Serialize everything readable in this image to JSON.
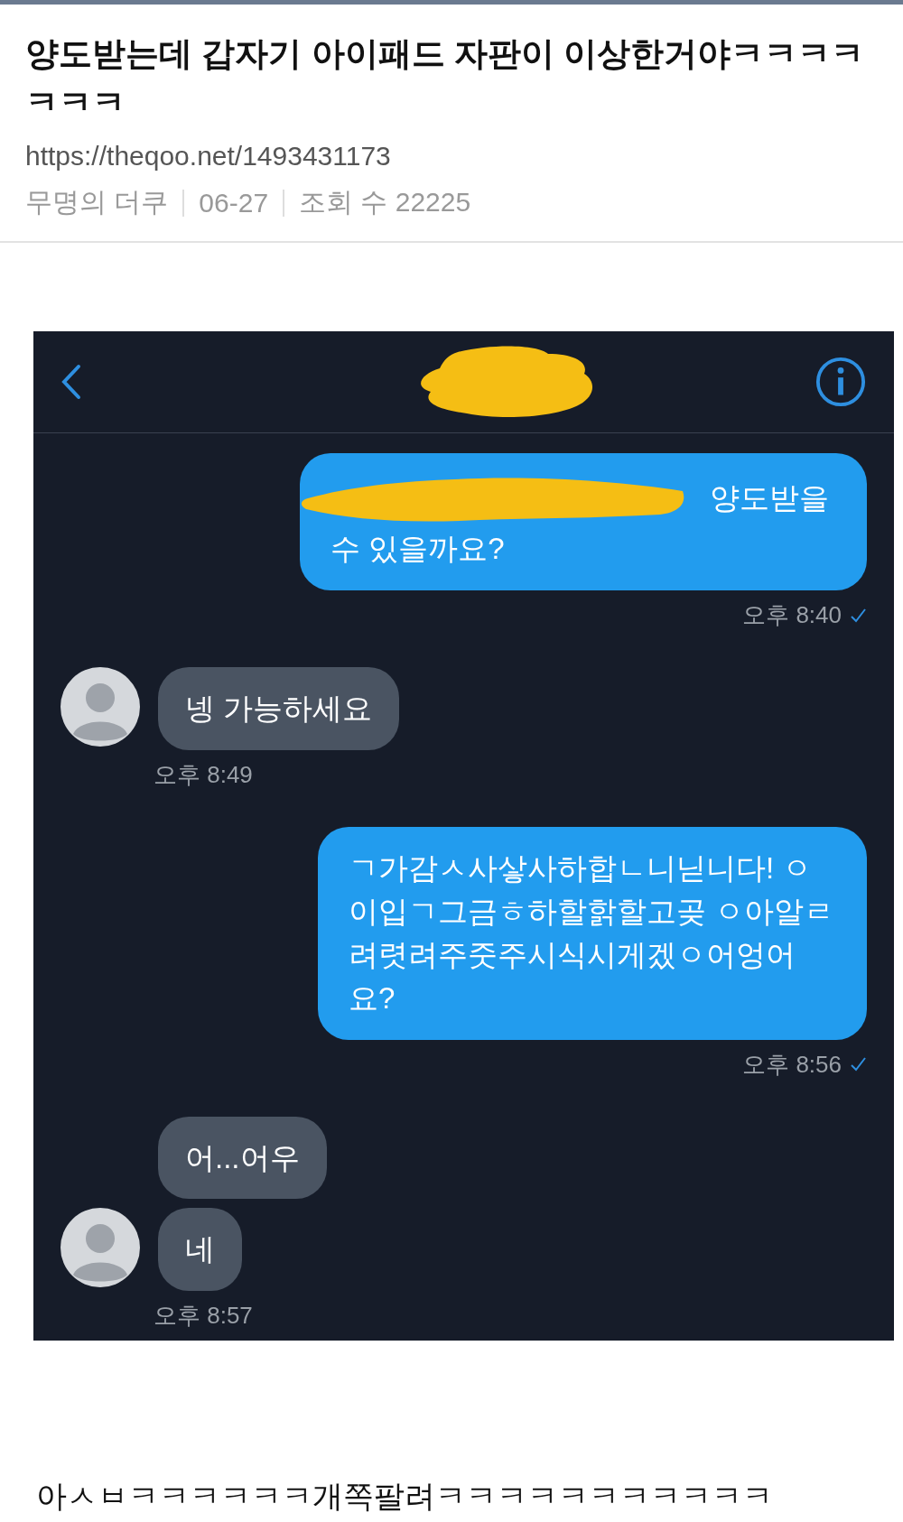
{
  "post": {
    "title": "양도받는데 갑자기 아이패드 자판이 이상한거야ㅋㅋㅋㅋㅋㅋㅋ",
    "url": "https://theqoo.net/1493431173",
    "author": "무명의 더쿠",
    "date": "06-27",
    "views": "조회 수 22225"
  },
  "chat": {
    "contact_redacted": true,
    "messages": [
      {
        "kind": "sent",
        "redacted": true,
        "texts": [
          "양도받을 수 있을까요?"
        ],
        "time": "오후 8:40"
      },
      {
        "kind": "received",
        "redacted": false,
        "texts": [
          "넹 가능하세요"
        ],
        "time": "오후 8:49"
      },
      {
        "kind": "sent",
        "redacted": false,
        "texts": [
          "ㄱ가감ㅅ사샇사하합ㄴ니닏니다! ㅇ이입ㄱ그금ㅎ하할핡할고곶 ㅇ아알ㄹ려렷려주줏주시식시게겠ㅇ어엉어요?"
        ],
        "time": "오후 8:56"
      },
      {
        "kind": "received",
        "redacted": false,
        "texts": [
          "어...어우",
          "네"
        ],
        "time": "오후 8:57"
      }
    ]
  },
  "body": "아ㅅㅂㅋㅋㅋㅋㅋㅋ개쪽팔려ㅋㅋㅋㅋㅋㅋㅋㅋㅋㅋㅋ"
}
